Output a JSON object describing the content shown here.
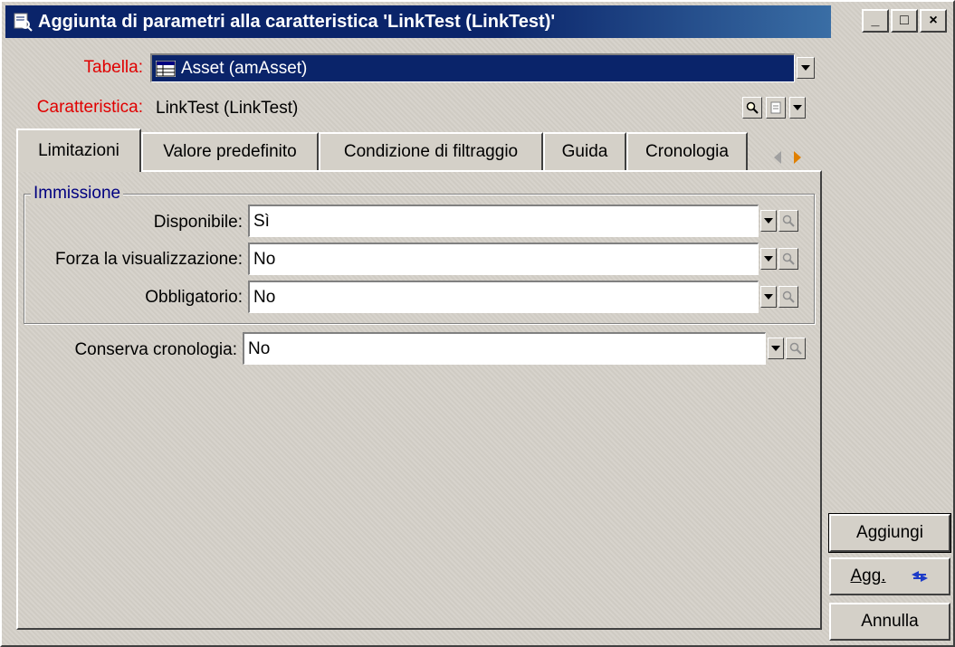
{
  "window": {
    "title": "Aggiunta di parametri alla caratteristica 'LinkTest (LinkTest)'",
    "controls": {
      "minimize": "_",
      "maximize": "□",
      "close": "×"
    }
  },
  "form": {
    "table_label": "Tabella:",
    "table_value": "Asset (amAsset)",
    "feature_label": "Caratteristica:",
    "feature_value": "LinkTest (LinkTest)"
  },
  "tabs": [
    {
      "label": "Limitazioni",
      "active": true
    },
    {
      "label": "Valore predefinito",
      "active": false
    },
    {
      "label": "Condizione di filtraggio",
      "active": false
    },
    {
      "label": "Guida",
      "active": false
    },
    {
      "label": "Cronologia",
      "active": false
    }
  ],
  "immissione": {
    "legend": "Immissione",
    "fields": [
      {
        "label": "Disponibile:",
        "value": "Sì"
      },
      {
        "label": "Forza la visualizzazione:",
        "value": "No"
      },
      {
        "label": "Obbligatorio:",
        "value": "No"
      }
    ]
  },
  "history_field": {
    "label": "Conserva cronologia:",
    "value": "No"
  },
  "buttons": {
    "add": "Aggiungi",
    "update": "Agg.",
    "cancel": "Annulla"
  },
  "colors": {
    "titlebar": "#0a246a",
    "required_label": "#e00000",
    "group_legend": "#000080",
    "face": "#d4d0c8"
  },
  "icons": [
    "dialog-icon",
    "table-icon",
    "magnifier-icon",
    "list-icon",
    "dropdown-arrow-icon",
    "tab-scroll-left-icon",
    "tab-scroll-right-icon",
    "refresh-icon"
  ]
}
